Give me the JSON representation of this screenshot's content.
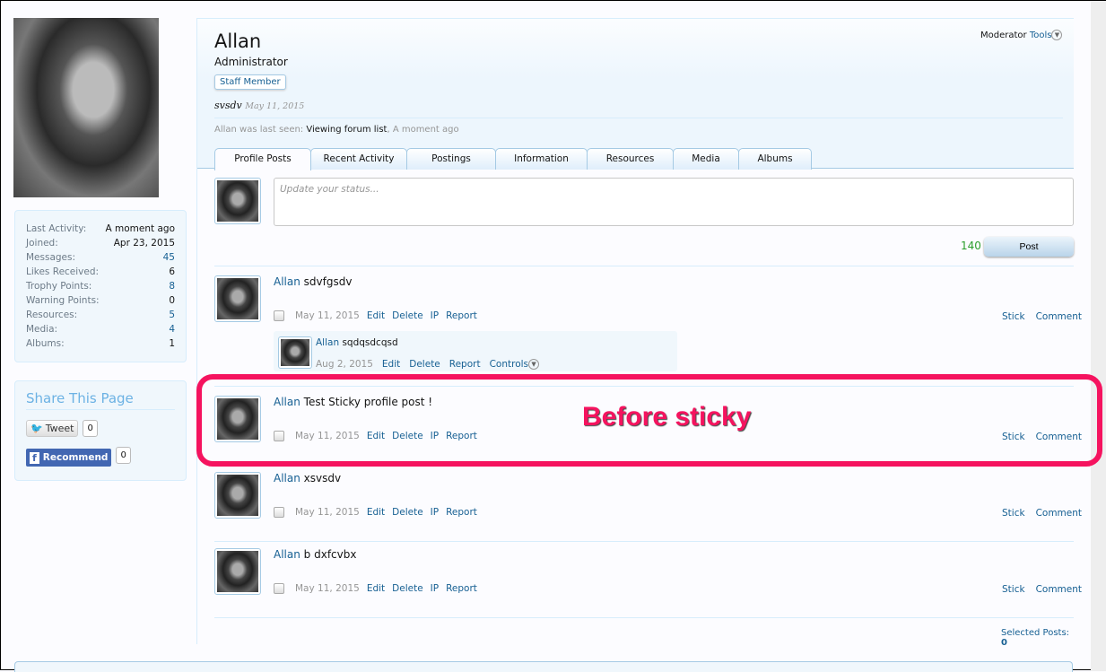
{
  "profile": {
    "name": "Allan",
    "user_title": "Administrator",
    "badge": "Staff Member",
    "status_text": "svsdv",
    "status_date": "May 11, 2015",
    "last_seen_prefix": "Allan was last seen:",
    "last_seen_activity": "Viewing forum list",
    "last_seen_time": "A moment ago",
    "moderator_label": "Moderator",
    "tools_label": "Tools"
  },
  "stats": [
    {
      "k": "Last Activity:",
      "v": "A moment ago",
      "link": false
    },
    {
      "k": "Joined:",
      "v": "Apr 23, 2015",
      "link": false
    },
    {
      "k": "Messages:",
      "v": "45",
      "link": true
    },
    {
      "k": "Likes Received:",
      "v": "6",
      "link": false
    },
    {
      "k": "Trophy Points:",
      "v": "8",
      "link": true
    },
    {
      "k": "Warning Points:",
      "v": "0",
      "link": false
    },
    {
      "k": "Resources:",
      "v": "5",
      "link": true
    },
    {
      "k": "Media:",
      "v": "4",
      "link": true
    },
    {
      "k": "Albums:",
      "v": "1",
      "link": false
    }
  ],
  "share": {
    "title": "Share This Page",
    "tweet": "Tweet",
    "tweet_count": "0",
    "recommend": "Recommend",
    "recommend_count": "0"
  },
  "tabs": [
    "Profile Posts",
    "Recent Activity",
    "Postings",
    "Information",
    "Resources",
    "Media",
    "Albums"
  ],
  "composer": {
    "placeholder": "Update your status...",
    "remaining": "140",
    "post_label": "Post"
  },
  "actions": {
    "edit": "Edit",
    "delete": "Delete",
    "ip": "IP",
    "report": "Report",
    "stick": "Stick",
    "comment": "Comment",
    "controls": "Controls"
  },
  "posts": [
    {
      "author": "Allan",
      "text": "sdvfgsdv",
      "date": "May 11, 2015"
    },
    {
      "author": "Allan",
      "text": "Test Sticky profile post !",
      "date": "May 11, 2015"
    },
    {
      "author": "Allan",
      "text": "xsvsdv",
      "date": "May 11, 2015"
    },
    {
      "author": "Allan",
      "text": "b dxfcvbx",
      "date": "May 11, 2015"
    }
  ],
  "comment": {
    "author": "Allan",
    "text": "sqdqsdcqsd",
    "date": "Aug 2, 2015"
  },
  "annotation": "Before sticky",
  "selected": {
    "label": "Selected Posts:",
    "count": "0"
  },
  "colors": {
    "highlight": "#f5135f",
    "link": "#176093",
    "border": "#a5cae4"
  }
}
